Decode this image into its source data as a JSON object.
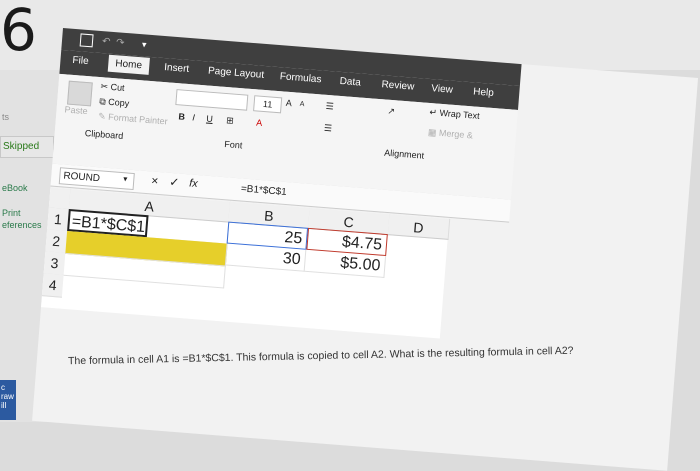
{
  "page_number": "6",
  "left_nav": {
    "items": [
      "ts",
      "Skipped",
      "eBook",
      "Print",
      "eferences"
    ],
    "draw_badge": "c\nraw\nill"
  },
  "quick_access": {
    "save_icon": "save-icon"
  },
  "tabs": [
    "File",
    "Home",
    "Insert",
    "Page Layout",
    "Formulas",
    "Data",
    "Review",
    "View",
    "Help"
  ],
  "active_tab": "Home",
  "ribbon": {
    "paste": "Paste",
    "cut": "Cut",
    "copy": "Copy",
    "format_painter": "Format Painter",
    "clipboard": "Clipboard",
    "font_size": "11",
    "bold": "B",
    "italic": "I",
    "underline": "U",
    "font": "Font",
    "wrap_text": "Wrap Text",
    "merge": "Merge &",
    "alignment": "Alignment",
    "grow_font": "A",
    "shrink_font": "A",
    "font_color": "A"
  },
  "formula_bar": {
    "name_box": "ROUND",
    "cancel": "×",
    "enter": "✓",
    "fx": "fx",
    "formula": "=B1*$C$1"
  },
  "grid": {
    "columns": [
      "A",
      "B",
      "C",
      "D"
    ],
    "rows": [
      "1",
      "2",
      "3",
      "4"
    ],
    "a1": "=B1*$C$1",
    "b1": "25",
    "b2": "30",
    "c1": "$4.75",
    "c2": "$5.00"
  },
  "question": "The formula in cell A1 is =B1*$C$1. This formula is copied to cell A2. What is the resulting formula in cell A2?",
  "colors": {
    "ribbon_dark": "#3f3f3f",
    "fill_yellow": "#e6cf2a",
    "ref_blue": "#3a6fd8",
    "ref_red": "#c0392b"
  }
}
